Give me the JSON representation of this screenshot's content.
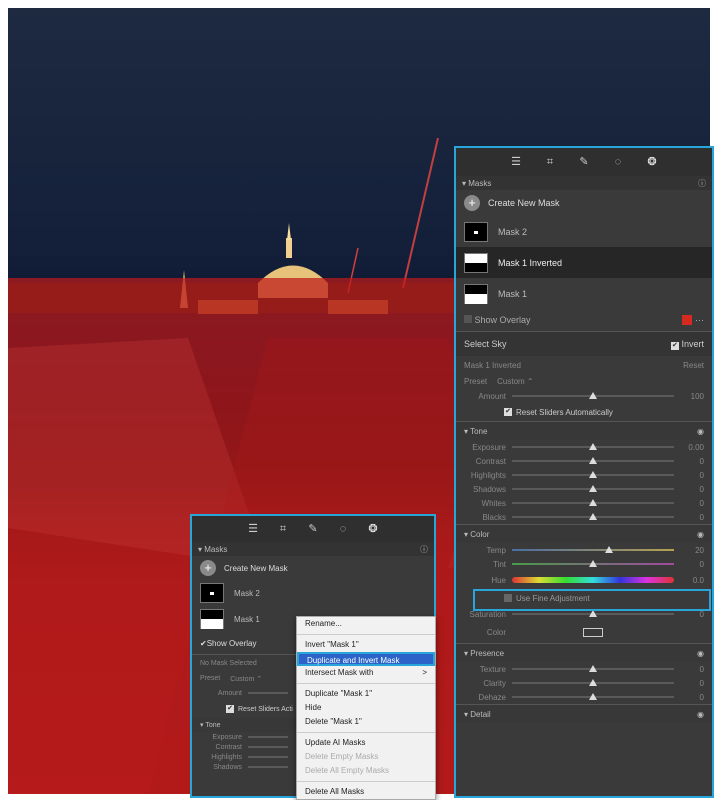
{
  "main_panel": {
    "section_title": "Masks",
    "create_label": "Create New Mask",
    "masks": [
      {
        "label": "Mask 2",
        "selected": false
      },
      {
        "label": "Mask 1 Inverted",
        "selected": true
      },
      {
        "label": "Mask 1",
        "selected": false
      }
    ],
    "show_overlay": "Show Overlay",
    "overlay_color": "#d42a1f",
    "select_sky": "Select Sky",
    "invert": "Invert",
    "mask_name": "Mask 1 Inverted",
    "reset": "Reset",
    "preset_label": "Preset",
    "preset_value": "Custom",
    "amount_label": "Amount",
    "amount_value": "100",
    "reset_sliders": "Reset Sliders Automatically",
    "tone_title": "Tone",
    "tone": [
      {
        "label": "Exposure",
        "value": "0.00"
      },
      {
        "label": "Contrast",
        "value": "0"
      },
      {
        "label": "Highlights",
        "value": "0"
      },
      {
        "label": "Shadows",
        "value": "0"
      },
      {
        "label": "Whites",
        "value": "0"
      },
      {
        "label": "Blacks",
        "value": "0"
      }
    ],
    "color_title": "Color",
    "temp_label": "Temp",
    "temp_value": "20",
    "tint_label": "Tint",
    "tint_value": "0",
    "hue_label": "Hue",
    "hue_value": "0.0",
    "fine_adj": "Use Fine Adjustment",
    "saturation_label": "Saturation",
    "saturation_value": "0",
    "color_label": "Color",
    "presence_title": "Presence",
    "presence": [
      {
        "label": "Texture",
        "value": "0"
      },
      {
        "label": "Clarity",
        "value": "0"
      },
      {
        "label": "Dehaze",
        "value": "0"
      }
    ],
    "detail_title": "Detail"
  },
  "small_panel": {
    "section_title": "Masks",
    "create_label": "Create New Mask",
    "masks": [
      {
        "label": "Mask 2"
      },
      {
        "label": "Mask 1"
      }
    ],
    "show_overlay": "Show Overlay",
    "no_mask": "No Mask Selected",
    "preset_label": "Preset",
    "preset_value": "Custom",
    "amount_label": "Amount",
    "reset_sliders": "Reset Sliders Acti",
    "tone_title": "Tone",
    "tone": [
      "Exposure",
      "Contrast",
      "Highlights",
      "Shadows"
    ]
  },
  "context_menu": {
    "items": [
      {
        "label": "Rename...",
        "disabled": false
      },
      {
        "sep": true
      },
      {
        "label": "Invert \"Mask 1\"",
        "disabled": false
      },
      {
        "label": "Duplicate and Invert Mask",
        "disabled": false,
        "highlighted": true
      },
      {
        "label": "Intersect Mask with",
        "disabled": false,
        "submenu": ">"
      },
      {
        "sep": true
      },
      {
        "label": "Duplicate \"Mask 1\"",
        "disabled": false
      },
      {
        "label": "Hide",
        "disabled": false
      },
      {
        "label": "Delete \"Mask 1\"",
        "disabled": false
      },
      {
        "sep": true
      },
      {
        "label": "Update AI Masks",
        "disabled": false
      },
      {
        "label": "Delete Empty Masks",
        "disabled": true
      },
      {
        "label": "Delete All Empty Masks",
        "disabled": true
      },
      {
        "sep": true
      },
      {
        "label": "Delete All Masks",
        "disabled": false
      }
    ]
  },
  "colors": {
    "accent": "#29a6d9",
    "mask_red": "#be1919",
    "panel_bg": "#3a3a3a"
  }
}
